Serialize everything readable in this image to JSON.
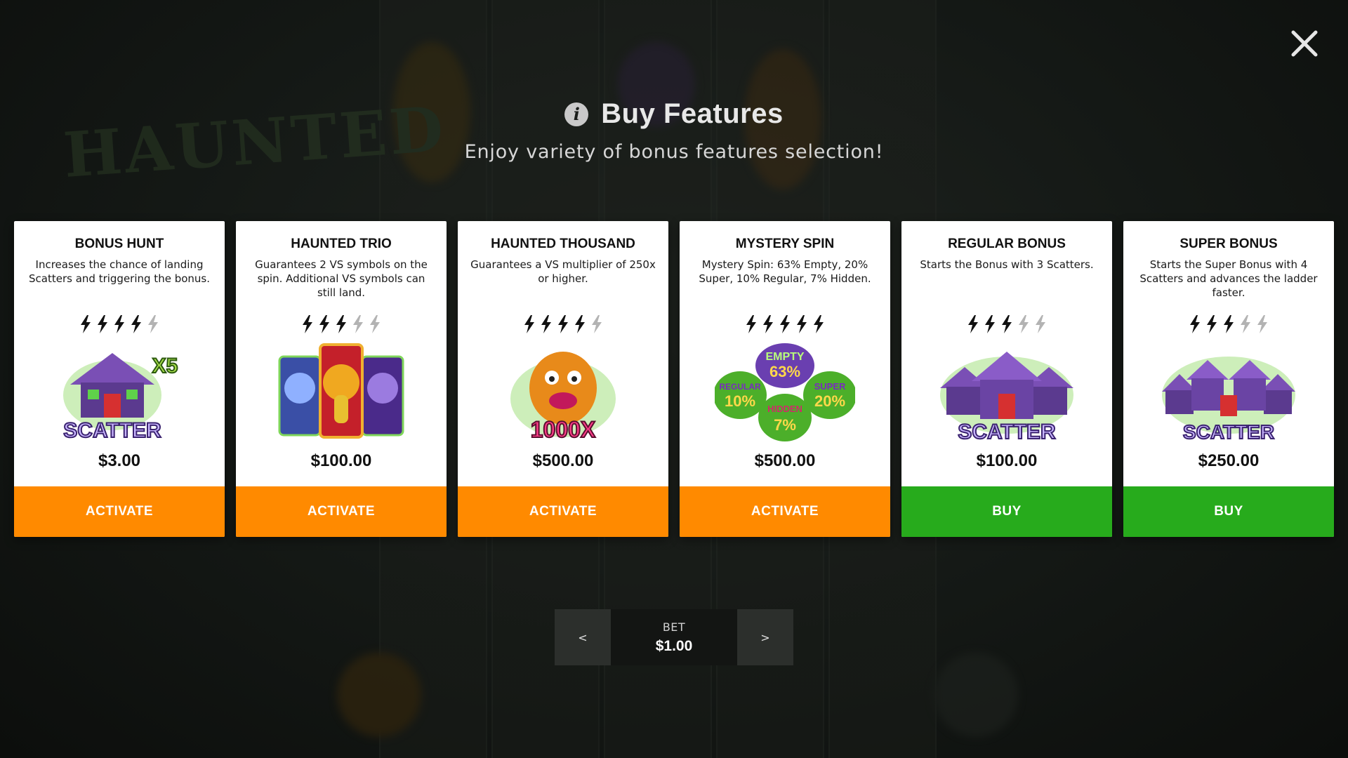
{
  "header": {
    "title": "Buy Features",
    "subtitle": "Enjoy variety of bonus features selection!"
  },
  "background_logo": "HAUNTED",
  "colors": {
    "activate_button": "#ff8a00",
    "buy_button": "#27ab1c",
    "bolt_active": "#111111",
    "bolt_inactive": "#b3b3b3"
  },
  "features": [
    {
      "title": "BONUS HUNT",
      "description": "Increases the chance of landing Scatters and triggering the bonus.",
      "volatility": 4,
      "volatility_max": 5,
      "image_icon": "scatter-x5-icon",
      "image_text": "SCATTER",
      "image_badge": "X5",
      "price": "$3.00",
      "button_label": "ACTIVATE",
      "button_type": "activate"
    },
    {
      "title": "HAUNTED TRIO",
      "description": "Guarantees 2 VS symbols on the spin. Additional VS symbols can still land.",
      "volatility": 3,
      "volatility_max": 5,
      "image_icon": "three-ghosts-icon",
      "price": "$100.00",
      "button_label": "ACTIVATE",
      "button_type": "activate"
    },
    {
      "title": "HAUNTED THOUSAND",
      "description": "Guarantees a VS multiplier of 250x or higher.",
      "volatility": 4,
      "volatility_max": 5,
      "image_icon": "monster-1000x-icon",
      "image_text": "1000X",
      "price": "$500.00",
      "button_label": "ACTIVATE",
      "button_type": "activate"
    },
    {
      "title": "MYSTERY SPIN",
      "description": "Mystery Spin: 63% Empty, 20% Super, 10% Regular, 7% Hidden.",
      "volatility": 5,
      "volatility_max": 5,
      "image_icon": "mystery-slime-icon",
      "image_labels": [
        "EMPTY",
        "63%",
        "REGULAR",
        "10%",
        "HIDDEN",
        "7%",
        "SUPER",
        "20%"
      ],
      "price": "$500.00",
      "button_label": "ACTIVATE",
      "button_type": "activate"
    },
    {
      "title": "REGULAR BONUS",
      "description": "Starts the Bonus with 3 Scatters.",
      "volatility": 3,
      "volatility_max": 5,
      "image_icon": "three-houses-scatter-icon",
      "image_text": "SCATTER",
      "price": "$100.00",
      "button_label": "BUY",
      "button_type": "buy"
    },
    {
      "title": "SUPER BONUS",
      "description": "Starts the Super Bonus with 4 Scatters and advances the ladder faster.",
      "volatility": 3,
      "volatility_max": 5,
      "image_icon": "four-houses-scatter-icon",
      "image_text": "SCATTER",
      "price": "$250.00",
      "button_label": "BUY",
      "button_type": "buy"
    }
  ],
  "bet": {
    "label": "BET",
    "value": "$1.00",
    "decrease_label": "<",
    "increase_label": ">"
  }
}
